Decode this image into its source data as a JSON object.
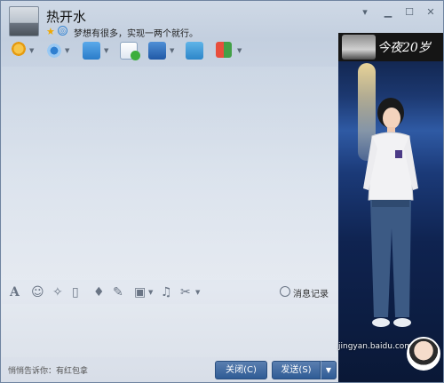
{
  "header": {
    "title": "热开水",
    "signature": "梦想有很多，实现一两个就行。",
    "window_controls": {
      "menu_icon": "chevron-down-icon",
      "minimize_icon": "minimize-icon",
      "maximize_icon": "maximize-icon",
      "close_icon": "close-icon"
    }
  },
  "toolbar": {
    "items": [
      {
        "name": "voice-call",
        "icon": "microphone-icon"
      },
      {
        "name": "video-call",
        "icon": "webcam-icon"
      },
      {
        "name": "transfer-file",
        "icon": "folder-transfer-icon"
      },
      {
        "name": "create-discussion",
        "icon": "add-chat-icon"
      },
      {
        "name": "remote-desktop",
        "icon": "monitor-icon"
      },
      {
        "name": "share-screen",
        "icon": "screen-share-icon"
      },
      {
        "name": "apps",
        "icon": "apps-grid-icon"
      }
    ]
  },
  "bottom_toolbar": {
    "tools": [
      {
        "name": "font",
        "icon": "font-icon",
        "glyph": "A"
      },
      {
        "name": "emoji",
        "icon": "smiley-icon",
        "glyph": "☺"
      },
      {
        "name": "magic",
        "icon": "magic-wand-icon",
        "glyph": "✧"
      },
      {
        "name": "shake",
        "icon": "shake-window-icon",
        "glyph": "▯"
      },
      {
        "name": "voice",
        "icon": "microphone-icon",
        "glyph": "♦"
      },
      {
        "name": "write",
        "icon": "edit-icon",
        "glyph": "✎"
      },
      {
        "name": "image",
        "icon": "image-icon",
        "glyph": "▣"
      },
      {
        "name": "music",
        "icon": "music-icon",
        "glyph": "♫"
      },
      {
        "name": "screenshot",
        "icon": "scissors-icon",
        "glyph": "✂"
      }
    ],
    "history_label": "消息记录"
  },
  "input": {
    "tip": "悄悄告诉你：有红包拿"
  },
  "buttons": {
    "close_label": "关闭(C)",
    "send_label": "发送(S)",
    "send_menu": "▼"
  },
  "show_panel": {
    "banner_text": "今夜20岁",
    "watermark": "jingyan.baidu.com"
  }
}
